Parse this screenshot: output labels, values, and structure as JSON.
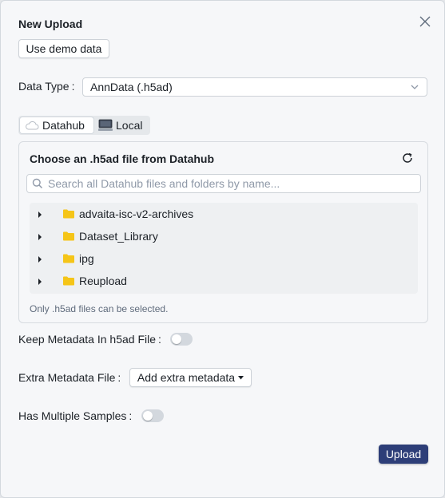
{
  "dialog": {
    "title": "New Upload",
    "demo_button": "Use demo data"
  },
  "data_type": {
    "label": "Data Type",
    "selected": "AnnData (.h5ad)"
  },
  "source_tabs": [
    {
      "label": "Datahub",
      "icon": "cloud-icon",
      "active": true
    },
    {
      "label": "Local",
      "icon": "computer-icon",
      "active": false
    }
  ],
  "file_panel": {
    "title": "Choose an .h5ad file from Datahub",
    "search_placeholder": "Search all Datahub files and folders by name...",
    "folders": [
      {
        "name": "advaita-isc-v2-archives"
      },
      {
        "name": "Dataset_Library"
      },
      {
        "name": "ipg"
      },
      {
        "name": "Reupload"
      }
    ],
    "note": "Only .h5ad files can be selected."
  },
  "keep_metadata": {
    "label": "Keep Metadata In h5ad File",
    "on": false
  },
  "extra_metadata": {
    "label": "Extra Metadata File",
    "button": "Add extra metadata"
  },
  "multiple_samples": {
    "label": "Has Multiple Samples",
    "on": false
  },
  "footer": {
    "upload_button": "Upload"
  },
  "colors": {
    "primary": "#2d3e78",
    "folder": "#f5c518",
    "background": "#f6f7f9"
  }
}
